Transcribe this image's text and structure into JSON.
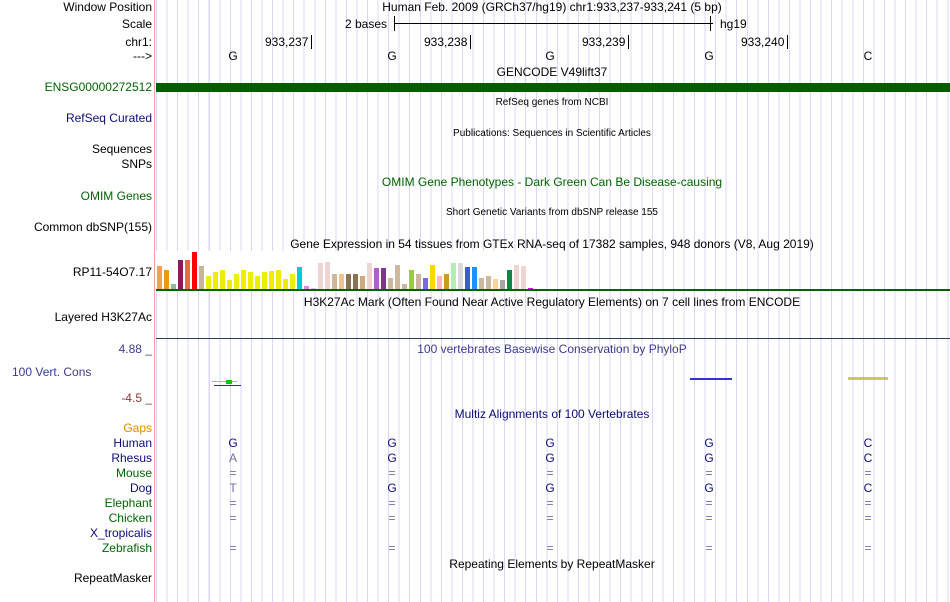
{
  "header": {
    "window_position_label": "Window Position",
    "assembly": "Human Feb. 2009 (GRCh37/hg19)   chr1:933,237-933,241 (5 bp)",
    "scale_label": "Scale",
    "scale_text": "2 bases",
    "scale_db": "hg19",
    "chr_label": "chr1:",
    "strand_label": "--->",
    "positions": [
      "933,237",
      "933,238",
      "933,239",
      "933,240"
    ],
    "bases": [
      "G",
      "G",
      "G",
      "G",
      "C"
    ]
  },
  "tracks": {
    "gencode_title": "GENCODE V49lift37",
    "gencode_gene": "ENSG00000272512",
    "refseq_title": "RefSeq genes from NCBI",
    "refseq_label": "RefSeq Curated",
    "pubs_title": "Publications: Sequences in Scientific Articles",
    "sequences_label": "Sequences",
    "snps_label": "SNPs",
    "omim_title": "OMIM Gene Phenotypes - Dark Green Can Be Disease-causing",
    "omim_label": "OMIM Genes",
    "dbsnp_title": "Short Genetic Variants from dbSNP release 155",
    "dbsnp_label": "Common dbSNP(155)",
    "gtex_title": "Gene Expression in 54 tissues from GTEx RNA-seq of 17382 samples, 948 donors (V8, Aug 2019)",
    "gtex_label": "RP11-54O7.17",
    "h3k_title": "H3K27Ac Mark (Often Found Near Active Regulatory Elements) on 7 cell lines from ENCODE",
    "h3k_label": "Layered H3K27Ac",
    "phylop_title": "100 vertebrates Basewise Conservation by PhyloP",
    "phylop_label": "100 Vert. Cons",
    "phylop_max": "4.88 _",
    "phylop_min": "-4.5 _",
    "multiz_title": "Multiz Alignments of 100 Vertebrates",
    "gaps_label": "Gaps",
    "species": [
      {
        "name": "Human",
        "color": "#0c0c78",
        "bases": [
          "G",
          "G",
          "G",
          "G",
          "C"
        ]
      },
      {
        "name": "Rhesus",
        "color": "#0c0c78",
        "bases": [
          "A",
          "G",
          "G",
          "G",
          "C"
        ]
      },
      {
        "name": "Mouse",
        "color": "#006400",
        "bases": [
          "=",
          "=",
          "=",
          "=",
          "="
        ]
      },
      {
        "name": "Dog",
        "color": "#0c0c78",
        "bases": [
          "T",
          "G",
          "G",
          "G",
          "C"
        ]
      },
      {
        "name": "Elephant",
        "color": "#006400",
        "bases": [
          "=",
          "=",
          "=",
          "=",
          "="
        ]
      },
      {
        "name": "Chicken",
        "color": "#006400",
        "bases": [
          "=",
          "=",
          "=",
          "=",
          "="
        ]
      },
      {
        "name": "X_tropicalis",
        "color": "#0c0c78",
        "bases": [
          "",
          "",
          "",
          "",
          ""
        ]
      },
      {
        "name": "Zebrafish",
        "color": "#006400",
        "bases": [
          "=",
          "=",
          "=",
          "=",
          "="
        ]
      }
    ],
    "repeat_title": "Repeating Elements by RepeatMasker",
    "repeat_label": "RepeatMasker"
  },
  "chart_data": {
    "type": "bar",
    "title": "GTEx expression (relative)",
    "values": [
      68,
      56,
      16,
      85,
      85,
      110,
      68,
      40,
      50,
      58,
      28,
      44,
      58,
      50,
      40,
      50,
      54,
      58,
      31,
      46,
      64,
      8,
      2,
      78,
      80,
      46,
      44,
      44,
      46,
      38,
      78,
      62,
      62,
      34,
      72,
      16,
      58,
      46,
      32,
      72,
      38,
      46,
      78,
      78,
      64,
      64,
      34,
      40,
      30,
      28,
      56,
      72,
      68,
      4
    ],
    "colors": [
      "#f5a04c",
      "#e89a10",
      "#8fbc8f",
      "#8b1a5a",
      "#e8684a",
      "#ff0000",
      "#c8b49a",
      "#eeee00",
      "#eeee00",
      "#eeee00",
      "#eeee00",
      "#eeee00",
      "#eeee00",
      "#eeee00",
      "#eeee00",
      "#eeee00",
      "#eeee00",
      "#eeee00",
      "#eeee00",
      "#eeee00",
      "#00cdcd",
      "#ee82ee",
      "#cccccc",
      "#eed5d2",
      "#eed5d2",
      "#cdb79e",
      "#eec591",
      "#8b7355",
      "#8b7355",
      "#cdaa7d",
      "#eed5d2",
      "#b45fcd",
      "#7a378b",
      "#cdb79e",
      "#cdb79e",
      "#cdb79e",
      "#9acd32",
      "#cdb79e",
      "#7b68ee",
      "#ffd700",
      "#ffb6c1",
      "#cd9b1d",
      "#b4eeb4",
      "#d9d9d9",
      "#3a5fcd",
      "#1e90ff",
      "#cdb79e",
      "#cdb79e",
      "#ffd39b",
      "#a6a6a6",
      "#008b45",
      "#eed5d2",
      "#eed5d2",
      "#ee00ee"
    ],
    "ylim": [
      0,
      110
    ]
  }
}
